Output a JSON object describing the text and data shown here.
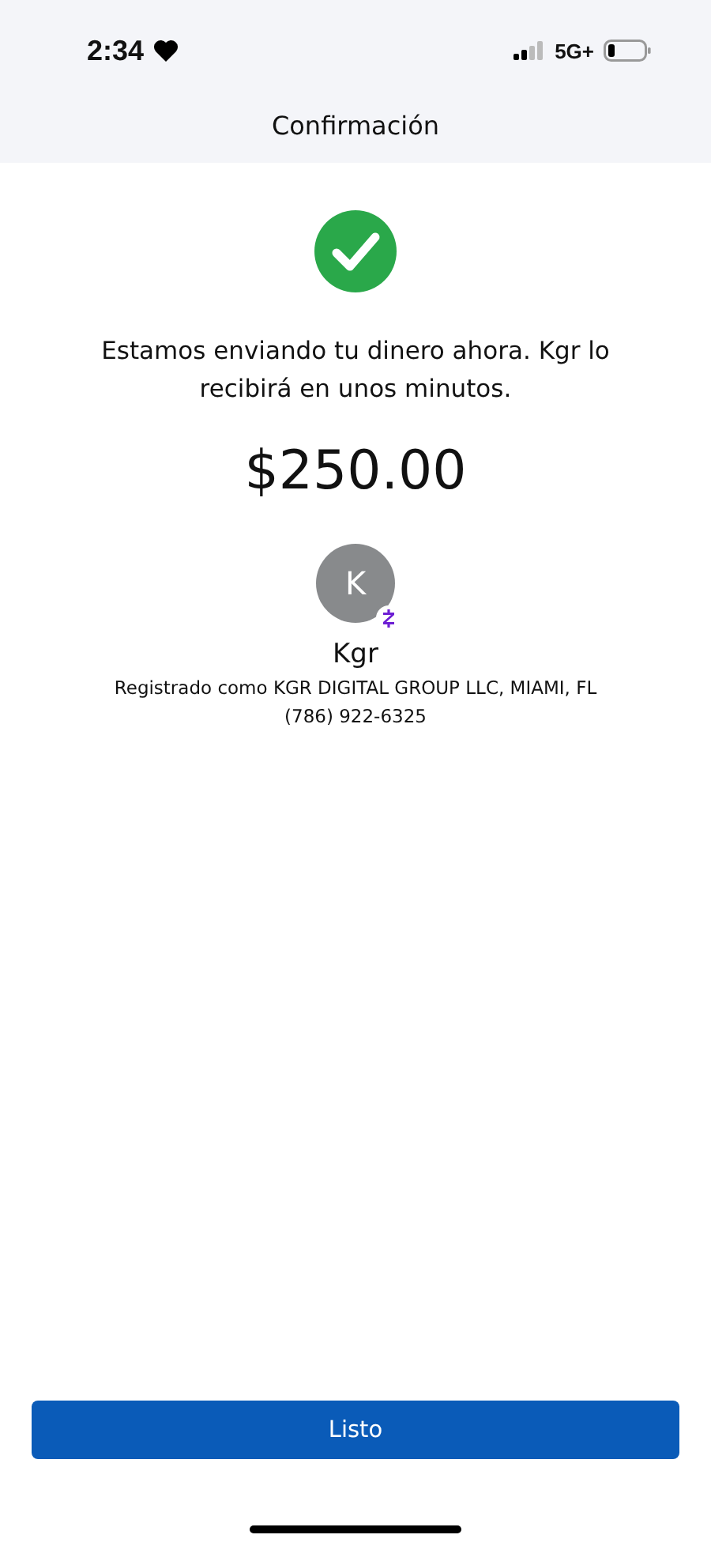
{
  "status_bar": {
    "time": "2:34",
    "network": "5G+"
  },
  "header": {
    "title": "Confirmación"
  },
  "confirmation": {
    "message": "Estamos enviando tu dinero ahora. Kgr lo recibirá en unos minutos.",
    "amount": "$250.00"
  },
  "recipient": {
    "initial": "K",
    "name": "Kgr",
    "registered": "Registrado como KGR DIGITAL GROUP LLC, MIAMI, FL",
    "phone": "(786) 922-6325"
  },
  "buttons": [
    {
      "label": "Listo"
    }
  ]
}
